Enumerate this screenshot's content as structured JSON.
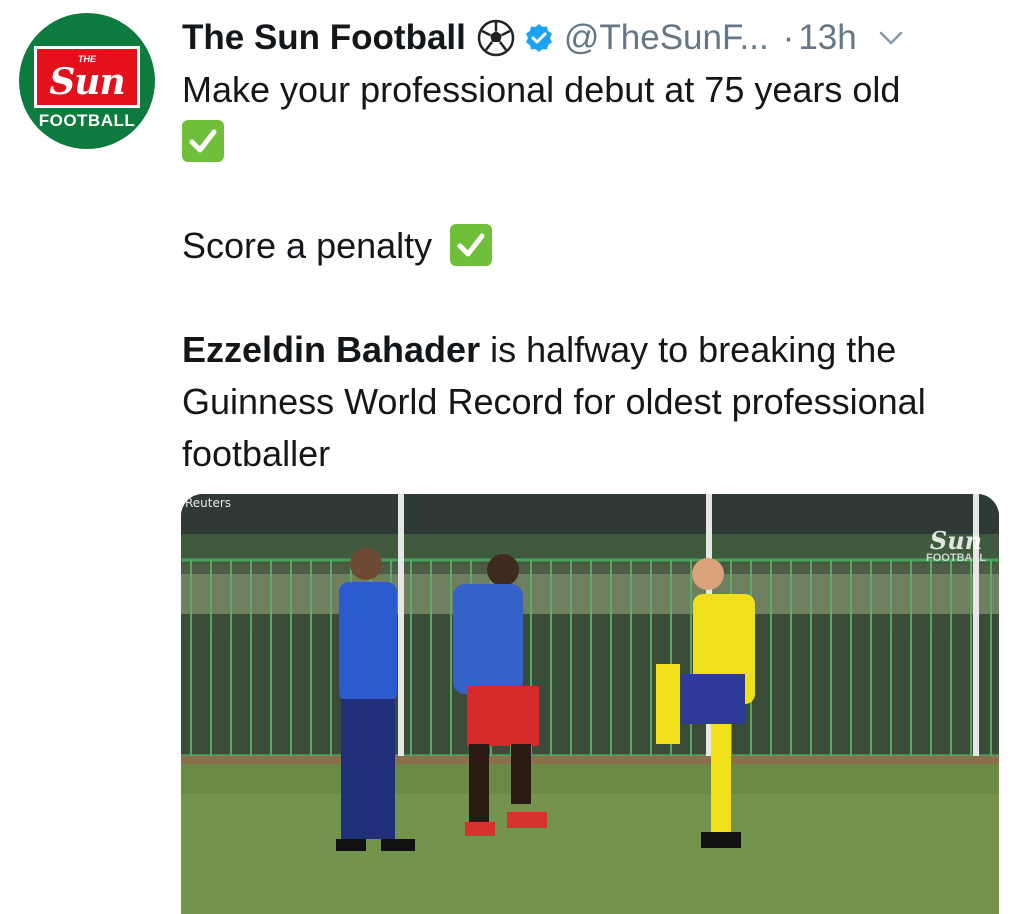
{
  "tweet": {
    "author_name": "The Sun Football",
    "handle": "@TheSunF...",
    "separator": "·",
    "time": "13h",
    "avatar": {
      "small_label": "THE",
      "logo_text": "Sun",
      "caption": "FOOTBALL"
    },
    "lines": {
      "line1": "Make your professional debut at 75 years old",
      "line2": "Score a penalty",
      "line3_bold": "Ezzeldin Bahader",
      "line3_rest": " is halfway to breaking the Guinness World Record for oldest professional footballer"
    },
    "icons": {
      "author_badge": "soccer-ball-icon",
      "verified": "verified-badge-icon",
      "menu": "chevron-down-icon",
      "emoji": "check-mark-button-icon"
    },
    "media": {
      "watermark": "Reuters",
      "logo_top": "Sun",
      "logo_bottom": "FOOTBALL"
    }
  },
  "colors": {
    "text": "#14171a",
    "secondary": "#657786",
    "verified_blue": "#1da1f2",
    "check_green": "#6fbf3a",
    "brand_red": "#e4101b",
    "brand_green": "#0d7a3e"
  }
}
